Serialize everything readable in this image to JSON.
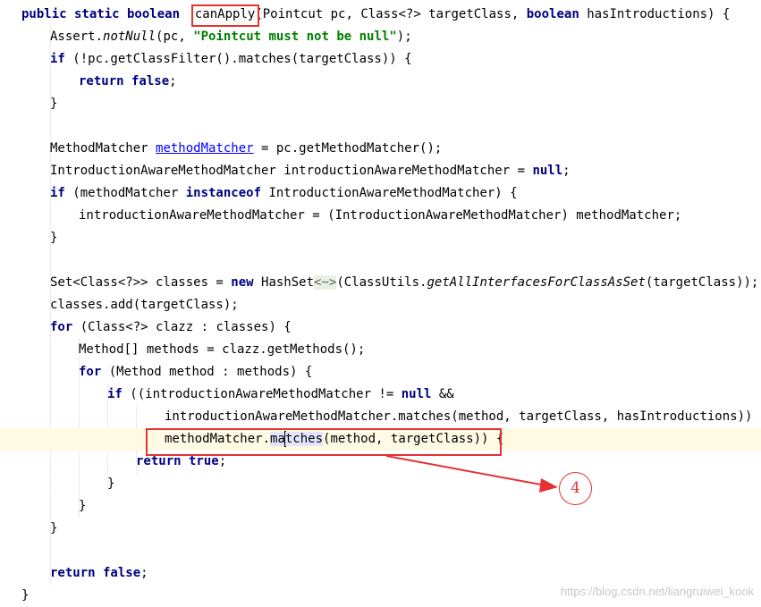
{
  "editor": {
    "lines": [
      {
        "indent": 0,
        "tokens": [
          [
            "kw",
            "public static boolean "
          ],
          [
            "p",
            " "
          ],
          [
            "p",
            "canApply"
          ],
          [
            "p",
            "(Pointcut pc, Class<?> targetClass, "
          ],
          [
            "kw",
            "boolean"
          ],
          [
            "p",
            " hasIntroductions) {"
          ]
        ]
      },
      {
        "indent": 1,
        "tokens": [
          [
            "p",
            "Assert."
          ],
          [
            "it",
            "notNull"
          ],
          [
            "p",
            "(pc, "
          ],
          [
            "str",
            "\"Pointcut must not be null\""
          ],
          [
            "p",
            ");"
          ]
        ]
      },
      {
        "indent": 1,
        "tokens": [
          [
            "kw",
            "if"
          ],
          [
            "p",
            " (!pc.getClassFilter().matches(targetClass)) {"
          ]
        ]
      },
      {
        "indent": 2,
        "tokens": [
          [
            "kw",
            "return false"
          ],
          [
            "p",
            ";"
          ]
        ]
      },
      {
        "indent": 1,
        "tokens": [
          [
            "p",
            "}"
          ]
        ]
      },
      {
        "indent": 0,
        "tokens": []
      },
      {
        "indent": 1,
        "tokens": [
          [
            "p",
            "MethodMatcher "
          ],
          [
            "link",
            "methodMatcher"
          ],
          [
            "p",
            " = pc.getMethodMatcher();"
          ]
        ]
      },
      {
        "indent": 1,
        "tokens": [
          [
            "p",
            "IntroductionAwareMethodMatcher introductionAwareMethodMatcher = "
          ],
          [
            "kw",
            "null"
          ],
          [
            "p",
            ";"
          ]
        ]
      },
      {
        "indent": 1,
        "tokens": [
          [
            "kw",
            "if"
          ],
          [
            "p",
            " (methodMatcher "
          ],
          [
            "kw",
            "instanceof"
          ],
          [
            "p",
            " IntroductionAwareMethodMatcher) {"
          ]
        ]
      },
      {
        "indent": 2,
        "tokens": [
          [
            "p",
            "introductionAwareMethodMatcher = (IntroductionAwareMethodMatcher) methodMatcher;"
          ]
        ]
      },
      {
        "indent": 1,
        "tokens": [
          [
            "p",
            "}"
          ]
        ]
      },
      {
        "indent": 0,
        "tokens": []
      },
      {
        "indent": 1,
        "tokens": [
          [
            "p",
            "Set<Class<?>> classes = "
          ],
          [
            "kw",
            "new"
          ],
          [
            "p",
            " HashSet"
          ],
          [
            "diamond",
            "<~>"
          ],
          [
            "p",
            "(ClassUtils."
          ],
          [
            "it",
            "getAllInterfacesForClassAsSet"
          ],
          [
            "p",
            "(targetClass));"
          ]
        ]
      },
      {
        "indent": 1,
        "tokens": [
          [
            "p",
            "classes.add(targetClass);"
          ]
        ]
      },
      {
        "indent": 1,
        "tokens": [
          [
            "kw",
            "for"
          ],
          [
            "p",
            " (Class<?> clazz : classes) {"
          ]
        ]
      },
      {
        "indent": 2,
        "tokens": [
          [
            "p",
            "Method[] methods = clazz.getMethods();"
          ]
        ]
      },
      {
        "indent": 2,
        "tokens": [
          [
            "kw",
            "for"
          ],
          [
            "p",
            " (Method method : methods) {"
          ]
        ]
      },
      {
        "indent": 3,
        "tokens": [
          [
            "kw",
            "if"
          ],
          [
            "p",
            " ((introductionAwareMethodMatcher != "
          ],
          [
            "kw",
            "null"
          ],
          [
            "p",
            " &&"
          ]
        ]
      },
      {
        "indent": 5,
        "tokens": [
          [
            "p",
            "introductionAwareMethodMatcher.matches(method, targetClass, hasIntroductions)) ||"
          ]
        ]
      },
      {
        "indent": 5,
        "current": true,
        "tokens": [
          [
            "p",
            "methodMatcher."
          ],
          [
            "hl",
            "ma"
          ],
          [
            "caret",
            ""
          ],
          [
            "hl",
            "tches"
          ],
          [
            "p",
            "(method, targetClass)) {"
          ]
        ]
      },
      {
        "indent": 4,
        "tokens": [
          [
            "kw",
            "return true"
          ],
          [
            "p",
            ";"
          ]
        ]
      },
      {
        "indent": 3,
        "tokens": [
          [
            "p",
            "}"
          ]
        ]
      },
      {
        "indent": 2,
        "tokens": [
          [
            "p",
            "}"
          ]
        ]
      },
      {
        "indent": 1,
        "tokens": [
          [
            "p",
            "}"
          ]
        ]
      },
      {
        "indent": 0,
        "tokens": []
      },
      {
        "indent": 1,
        "tokens": [
          [
            "kw",
            "return false"
          ],
          [
            "p",
            ";"
          ]
        ]
      },
      {
        "indent": 0,
        "tokens": [
          [
            "p",
            "}"
          ]
        ]
      }
    ]
  },
  "annotation": {
    "step_label": "4",
    "accent_color": "#e53333"
  },
  "watermark": "https://blog.csdn.net/liangruiwei_kook"
}
